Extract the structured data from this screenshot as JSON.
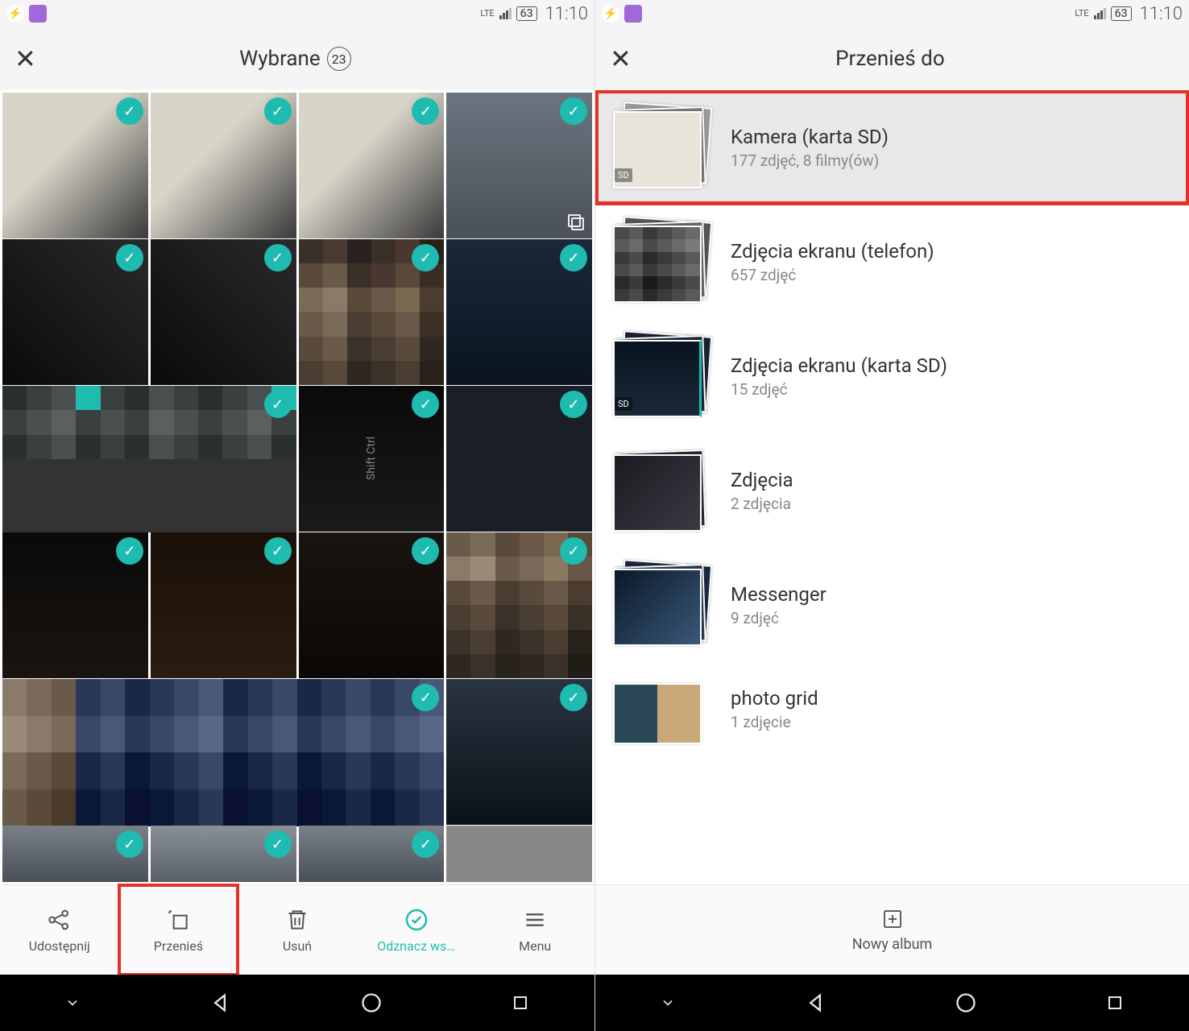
{
  "status": {
    "network": "LTE",
    "battery": "63",
    "time": "11:10"
  },
  "left": {
    "title": "Wybrane",
    "count": "23",
    "actions": [
      {
        "id": "share",
        "label": "Udostępnij"
      },
      {
        "id": "move",
        "label": "Przenieś",
        "highlight": true
      },
      {
        "id": "delete",
        "label": "Usuń"
      },
      {
        "id": "deselect",
        "label": "Odznacz ws…",
        "active": true
      },
      {
        "id": "menu",
        "label": "Menu"
      }
    ]
  },
  "right": {
    "title": "Przenieś do",
    "albums": [
      {
        "name": "Kamera (karta SD)",
        "sub": "177 zdjęć,  8 filmy(ów)",
        "highlight": true,
        "sd": true
      },
      {
        "name": "Zdjęcia ekranu (telefon)",
        "sub": "657 zdjęć"
      },
      {
        "name": "Zdjęcia ekranu (karta SD)",
        "sub": "15 zdjęć",
        "sd": true
      },
      {
        "name": "Zdjęcia",
        "sub": "2 zdjęcia"
      },
      {
        "name": "Messenger",
        "sub": "9 zdjęć"
      },
      {
        "name": "photo grid",
        "sub": "1 zdjęcie"
      }
    ],
    "newAlbum": "Nowy album"
  }
}
